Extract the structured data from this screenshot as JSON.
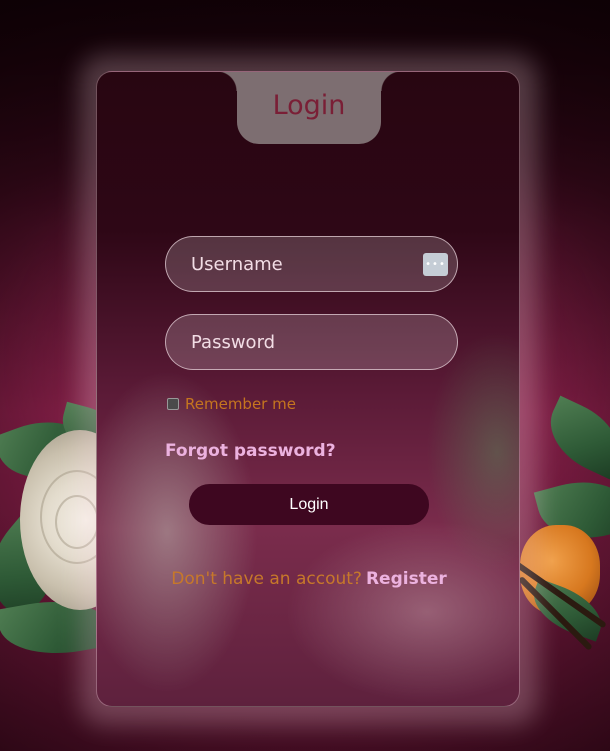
{
  "login_card": {
    "title": "Login",
    "username_placeholder": "Username",
    "password_placeholder": "Password",
    "remember_label": "Remember me",
    "forgot_link": "Forgot password?",
    "login_button": "Login",
    "register_prompt": "Don't have an accout?",
    "register_link": "Register"
  },
  "password_manager_icon": "more-dots-icon",
  "colors": {
    "title": "#7a1f36",
    "link": "#ecb2df",
    "accent_orange": "#c5751f",
    "button": "#3e0720"
  }
}
